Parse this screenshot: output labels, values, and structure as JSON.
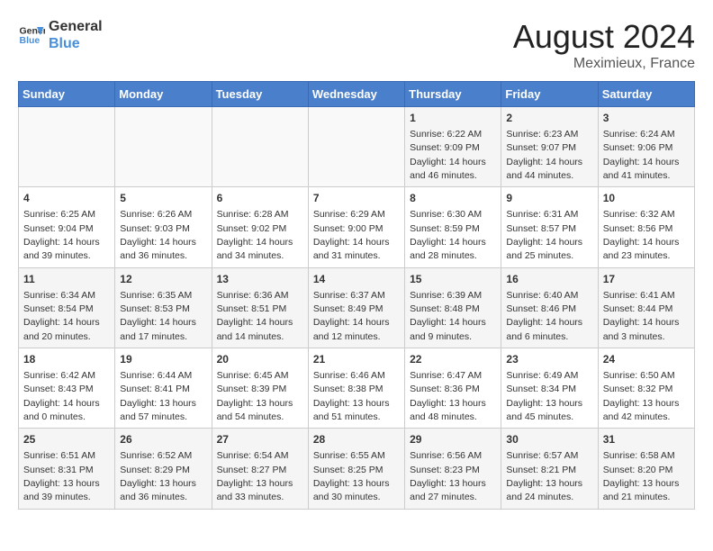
{
  "header": {
    "logo_line1": "General",
    "logo_line2": "Blue",
    "month_year": "August 2024",
    "location": "Meximieux, France"
  },
  "weekdays": [
    "Sunday",
    "Monday",
    "Tuesday",
    "Wednesday",
    "Thursday",
    "Friday",
    "Saturday"
  ],
  "weeks": [
    [
      {
        "day": "",
        "info": ""
      },
      {
        "day": "",
        "info": ""
      },
      {
        "day": "",
        "info": ""
      },
      {
        "day": "",
        "info": ""
      },
      {
        "day": "1",
        "info": "Sunrise: 6:22 AM\nSunset: 9:09 PM\nDaylight: 14 hours\nand 46 minutes."
      },
      {
        "day": "2",
        "info": "Sunrise: 6:23 AM\nSunset: 9:07 PM\nDaylight: 14 hours\nand 44 minutes."
      },
      {
        "day": "3",
        "info": "Sunrise: 6:24 AM\nSunset: 9:06 PM\nDaylight: 14 hours\nand 41 minutes."
      }
    ],
    [
      {
        "day": "4",
        "info": "Sunrise: 6:25 AM\nSunset: 9:04 PM\nDaylight: 14 hours\nand 39 minutes."
      },
      {
        "day": "5",
        "info": "Sunrise: 6:26 AM\nSunset: 9:03 PM\nDaylight: 14 hours\nand 36 minutes."
      },
      {
        "day": "6",
        "info": "Sunrise: 6:28 AM\nSunset: 9:02 PM\nDaylight: 14 hours\nand 34 minutes."
      },
      {
        "day": "7",
        "info": "Sunrise: 6:29 AM\nSunset: 9:00 PM\nDaylight: 14 hours\nand 31 minutes."
      },
      {
        "day": "8",
        "info": "Sunrise: 6:30 AM\nSunset: 8:59 PM\nDaylight: 14 hours\nand 28 minutes."
      },
      {
        "day": "9",
        "info": "Sunrise: 6:31 AM\nSunset: 8:57 PM\nDaylight: 14 hours\nand 25 minutes."
      },
      {
        "day": "10",
        "info": "Sunrise: 6:32 AM\nSunset: 8:56 PM\nDaylight: 14 hours\nand 23 minutes."
      }
    ],
    [
      {
        "day": "11",
        "info": "Sunrise: 6:34 AM\nSunset: 8:54 PM\nDaylight: 14 hours\nand 20 minutes."
      },
      {
        "day": "12",
        "info": "Sunrise: 6:35 AM\nSunset: 8:53 PM\nDaylight: 14 hours\nand 17 minutes."
      },
      {
        "day": "13",
        "info": "Sunrise: 6:36 AM\nSunset: 8:51 PM\nDaylight: 14 hours\nand 14 minutes."
      },
      {
        "day": "14",
        "info": "Sunrise: 6:37 AM\nSunset: 8:49 PM\nDaylight: 14 hours\nand 12 minutes."
      },
      {
        "day": "15",
        "info": "Sunrise: 6:39 AM\nSunset: 8:48 PM\nDaylight: 14 hours\nand 9 minutes."
      },
      {
        "day": "16",
        "info": "Sunrise: 6:40 AM\nSunset: 8:46 PM\nDaylight: 14 hours\nand 6 minutes."
      },
      {
        "day": "17",
        "info": "Sunrise: 6:41 AM\nSunset: 8:44 PM\nDaylight: 14 hours\nand 3 minutes."
      }
    ],
    [
      {
        "day": "18",
        "info": "Sunrise: 6:42 AM\nSunset: 8:43 PM\nDaylight: 14 hours\nand 0 minutes."
      },
      {
        "day": "19",
        "info": "Sunrise: 6:44 AM\nSunset: 8:41 PM\nDaylight: 13 hours\nand 57 minutes."
      },
      {
        "day": "20",
        "info": "Sunrise: 6:45 AM\nSunset: 8:39 PM\nDaylight: 13 hours\nand 54 minutes."
      },
      {
        "day": "21",
        "info": "Sunrise: 6:46 AM\nSunset: 8:38 PM\nDaylight: 13 hours\nand 51 minutes."
      },
      {
        "day": "22",
        "info": "Sunrise: 6:47 AM\nSunset: 8:36 PM\nDaylight: 13 hours\nand 48 minutes."
      },
      {
        "day": "23",
        "info": "Sunrise: 6:49 AM\nSunset: 8:34 PM\nDaylight: 13 hours\nand 45 minutes."
      },
      {
        "day": "24",
        "info": "Sunrise: 6:50 AM\nSunset: 8:32 PM\nDaylight: 13 hours\nand 42 minutes."
      }
    ],
    [
      {
        "day": "25",
        "info": "Sunrise: 6:51 AM\nSunset: 8:31 PM\nDaylight: 13 hours\nand 39 minutes."
      },
      {
        "day": "26",
        "info": "Sunrise: 6:52 AM\nSunset: 8:29 PM\nDaylight: 13 hours\nand 36 minutes."
      },
      {
        "day": "27",
        "info": "Sunrise: 6:54 AM\nSunset: 8:27 PM\nDaylight: 13 hours\nand 33 minutes."
      },
      {
        "day": "28",
        "info": "Sunrise: 6:55 AM\nSunset: 8:25 PM\nDaylight: 13 hours\nand 30 minutes."
      },
      {
        "day": "29",
        "info": "Sunrise: 6:56 AM\nSunset: 8:23 PM\nDaylight: 13 hours\nand 27 minutes."
      },
      {
        "day": "30",
        "info": "Sunrise: 6:57 AM\nSunset: 8:21 PM\nDaylight: 13 hours\nand 24 minutes."
      },
      {
        "day": "31",
        "info": "Sunrise: 6:58 AM\nSunset: 8:20 PM\nDaylight: 13 hours\nand 21 minutes."
      }
    ]
  ]
}
